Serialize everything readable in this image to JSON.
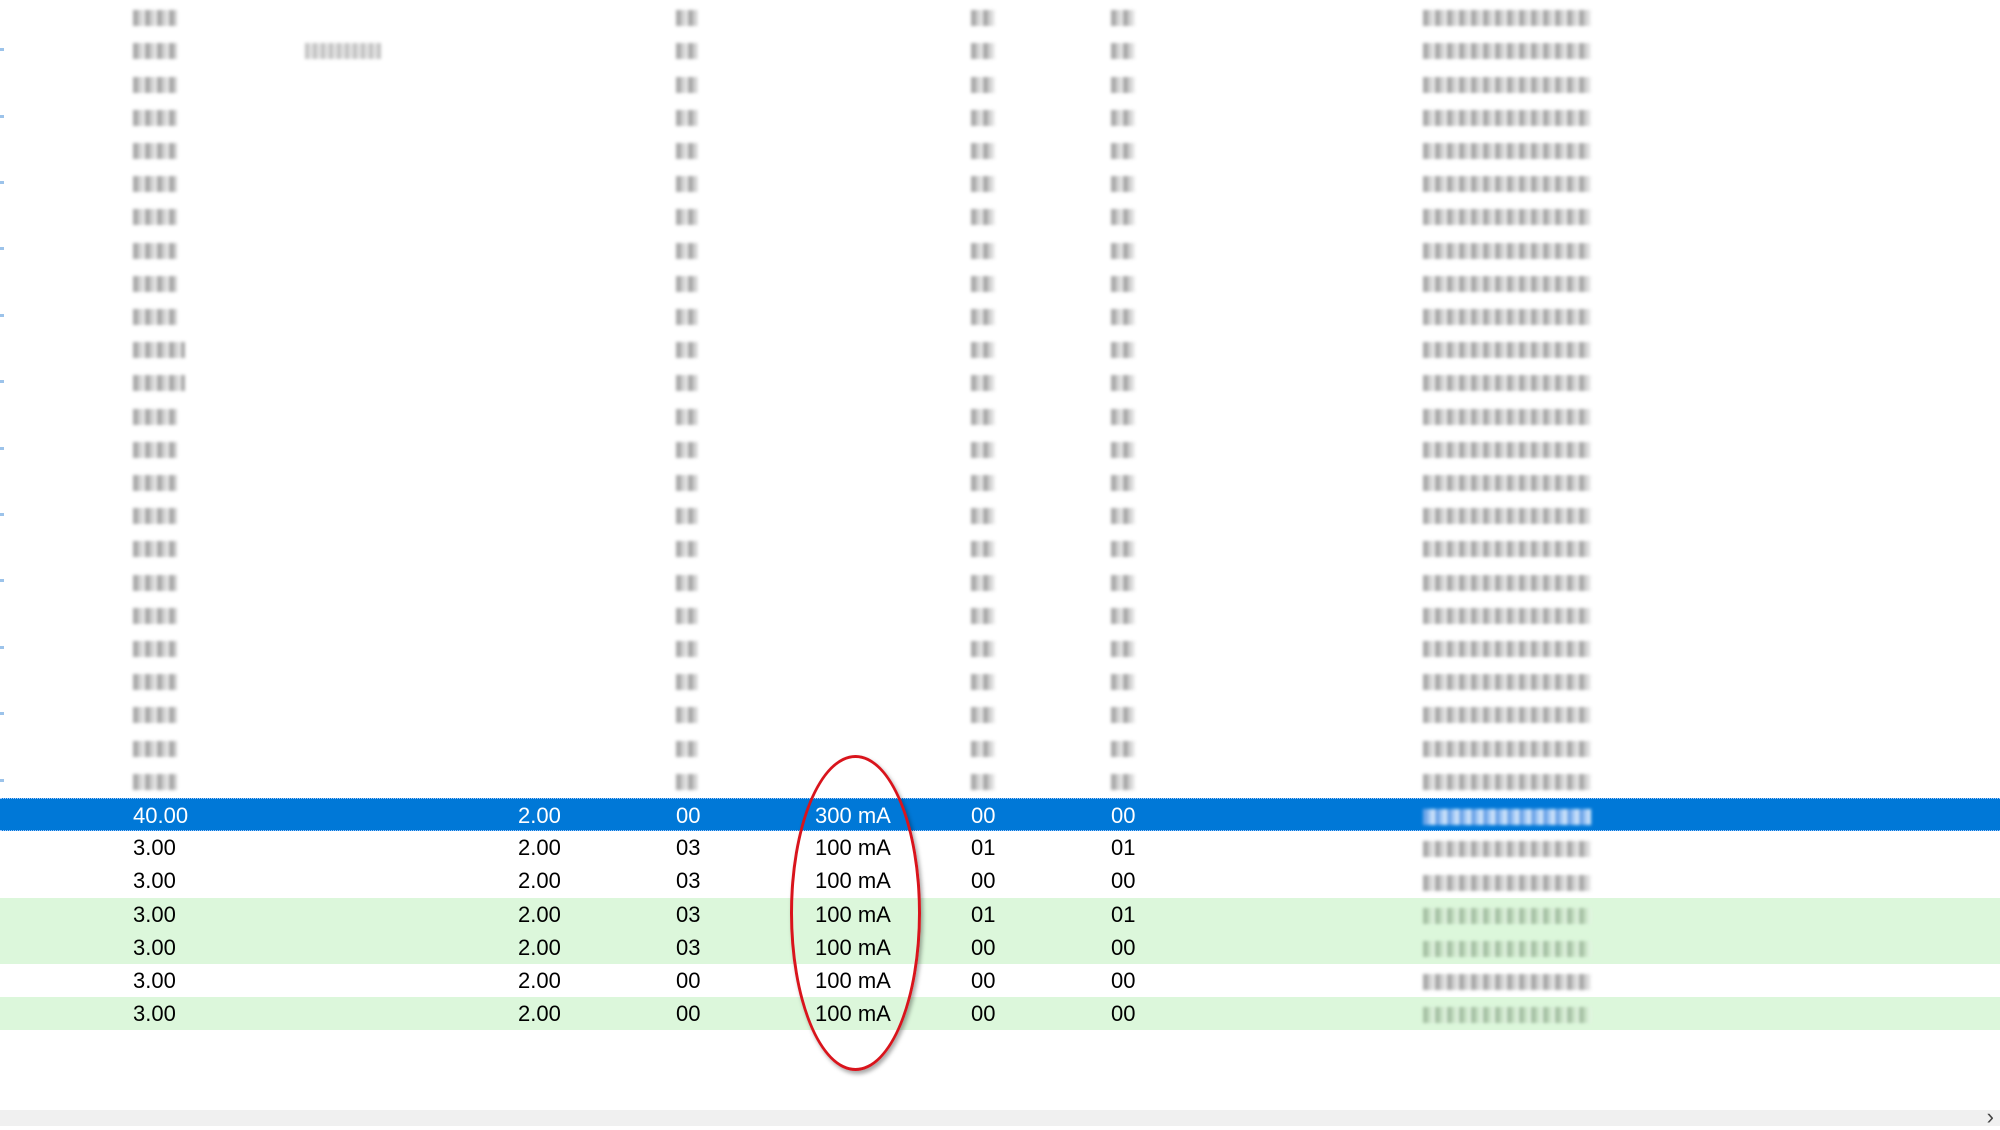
{
  "table": {
    "rows": [
      {
        "cells": [
          "40.00",
          "2.00",
          "00",
          "300 mA",
          "00",
          "00",
          ""
        ],
        "style": "selected"
      },
      {
        "cells": [
          "3.00",
          "2.00",
          "03",
          "100 mA",
          "01",
          "01",
          ""
        ],
        "style": "white"
      },
      {
        "cells": [
          "3.00",
          "2.00",
          "03",
          "100 mA",
          "00",
          "00",
          ""
        ],
        "style": "white"
      },
      {
        "cells": [
          "3.00",
          "2.00",
          "03",
          "100 mA",
          "01",
          "01",
          ""
        ],
        "style": "green"
      },
      {
        "cells": [
          "3.00",
          "2.00",
          "03",
          "100 mA",
          "00",
          "00",
          ""
        ],
        "style": "green"
      },
      {
        "cells": [
          "3.00",
          "2.00",
          "00",
          "100 mA",
          "00",
          "00",
          ""
        ],
        "style": "white"
      },
      {
        "cells": [
          "3.00",
          "2.00",
          "00",
          "100 mA",
          "00",
          "00",
          ""
        ],
        "style": "green"
      }
    ],
    "blurred_row_count": 24
  },
  "colors": {
    "selected_row": "#0078d7",
    "green_row": "#dcf7db",
    "annotation_oval": "#d9141c"
  },
  "icons": {
    "scroll_right": "›"
  }
}
